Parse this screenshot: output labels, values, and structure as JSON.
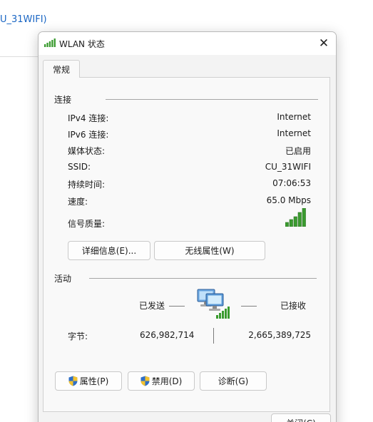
{
  "background_window": {
    "title": "U_31WIFI)"
  },
  "dialog": {
    "title": "WLAN 状态",
    "close_glyph": "✕",
    "tab_general": "常规",
    "connection": {
      "heading": "连接",
      "rows": [
        {
          "label": "IPv4 连接:",
          "value": "Internet"
        },
        {
          "label": "IPv6 连接:",
          "value": "Internet"
        },
        {
          "label": "媒体状态:",
          "value": "已启用"
        },
        {
          "label": "SSID:",
          "value": "CU_31WIFI"
        },
        {
          "label": "持续时间:",
          "value": "07:06:53"
        },
        {
          "label": "速度:",
          "value": "65.0 Mbps"
        }
      ],
      "signal_label": "信号质量:",
      "signal_bars": 5,
      "signal_level": 5,
      "details_button": "详细信息(E)...",
      "wireless_props_button": "无线属性(W)"
    },
    "activity": {
      "heading": "活动",
      "sent_label": "已发送",
      "received_label": "已接收",
      "bytes_label": "字节:",
      "bytes_sent": "626,982,714",
      "bytes_received": "2,665,389,725"
    },
    "buttons": {
      "properties": "属性(P)",
      "disable": "禁用(D)",
      "diagnose": "诊断(G)",
      "close": "关闭(C)"
    },
    "icons": {
      "title_icon": "wifi-signal-icon",
      "shield_icon": "uac-shield-icon",
      "network_icon": "network-computers-icon"
    },
    "colors": {
      "signal_green": "#3a9b2f",
      "link_blue": "#1a66c4",
      "shield_blue": "#2f6fc7",
      "shield_yellow": "#f2c230"
    }
  }
}
